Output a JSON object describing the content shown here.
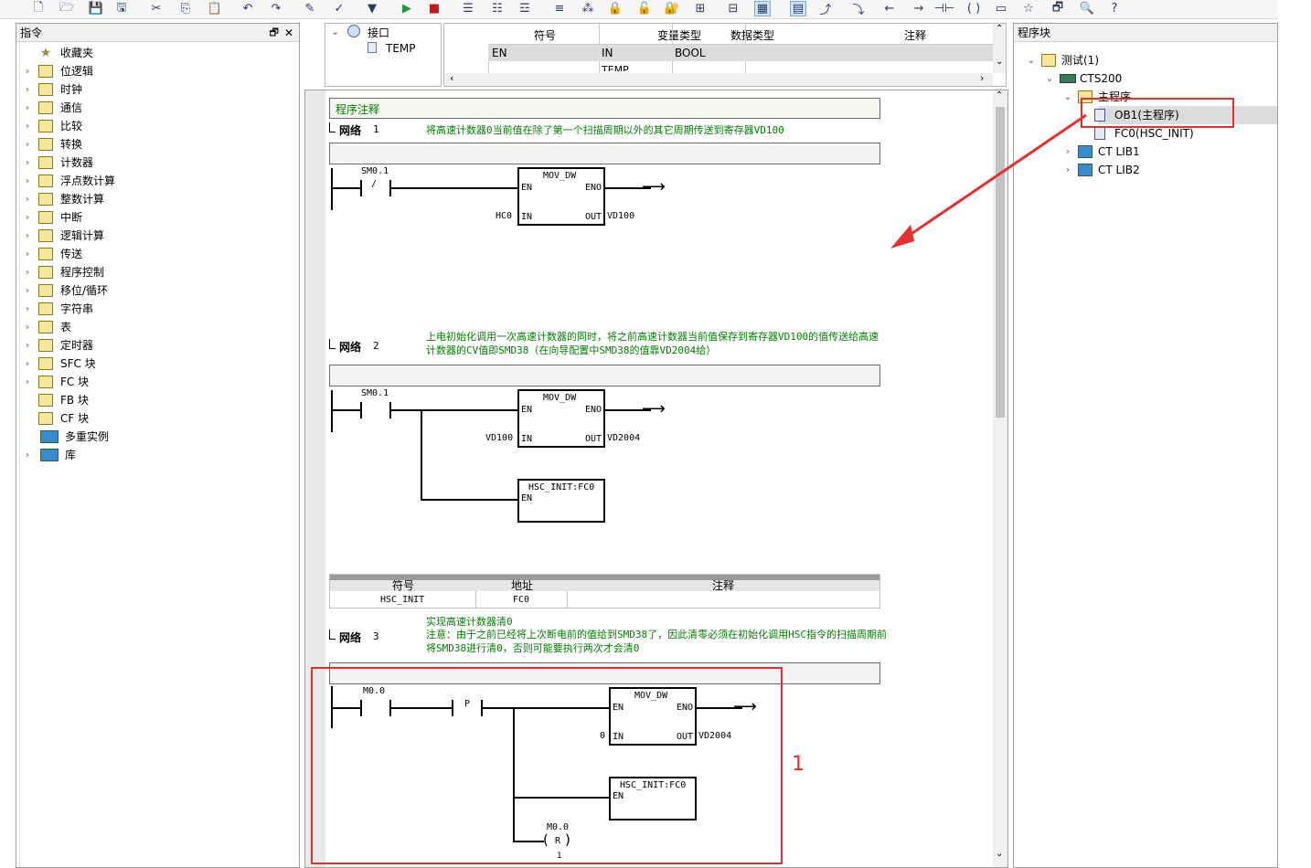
{
  "toolbar": {
    "icons": [
      "new-doc",
      "open-folder",
      "save",
      "save-all",
      "cut",
      "copy",
      "paste",
      "undo",
      "redo",
      "compile",
      "compile-all",
      "download",
      "run",
      "stop",
      "insert-network",
      "delete-network",
      "insert-row",
      "comment",
      "symbol",
      "lock-a",
      "lock-b",
      "lock-c",
      "mode-a",
      "mode-b",
      "ladder-view",
      "stl-view",
      "contact-up",
      "contact-down",
      "line-left",
      "line-right",
      "contact",
      "coil",
      "box",
      "bookmark",
      "window",
      "zoom",
      "help"
    ]
  },
  "left_panel": {
    "title": "指令",
    "items": [
      {
        "label": "收藏夹",
        "icon": "star-icon",
        "chevron": false
      },
      {
        "label": "位逻辑",
        "icon": "bit-logic-icon",
        "chevron": true
      },
      {
        "label": "时钟",
        "icon": "clock-icon",
        "chevron": true
      },
      {
        "label": "通信",
        "icon": "comm-icon",
        "chevron": true
      },
      {
        "label": "比较",
        "icon": "compare-icon",
        "chevron": true
      },
      {
        "label": "转换",
        "icon": "convert-icon",
        "chevron": true
      },
      {
        "label": "计数器",
        "icon": "counter-icon",
        "chevron": true
      },
      {
        "label": "浮点数计算",
        "icon": "float-icon",
        "chevron": true
      },
      {
        "label": "整数计算",
        "icon": "integer-icon",
        "chevron": true
      },
      {
        "label": "中断",
        "icon": "interrupt-icon",
        "chevron": true
      },
      {
        "label": "逻辑计算",
        "icon": "logic-icon",
        "chevron": true
      },
      {
        "label": "传送",
        "icon": "move-icon",
        "chevron": true
      },
      {
        "label": "程序控制",
        "icon": "program-control-icon",
        "chevron": true
      },
      {
        "label": "移位/循环",
        "icon": "shift-icon",
        "chevron": true
      },
      {
        "label": "字符串",
        "icon": "string-icon",
        "chevron": true
      },
      {
        "label": "表",
        "icon": "table-icon",
        "chevron": true
      },
      {
        "label": "定时器",
        "icon": "timer-icon",
        "chevron": true
      },
      {
        "label": "SFC 块",
        "icon": "sfc-icon",
        "chevron": true
      },
      {
        "label": "FC 块",
        "icon": "fc-icon",
        "chevron": true
      },
      {
        "label": "FB 块",
        "icon": "fb-icon",
        "chevron": false
      },
      {
        "label": "CF 块",
        "icon": "cf-icon",
        "chevron": false
      },
      {
        "label": "多重实例",
        "icon": "multi-instance-icon",
        "chevron": false
      },
      {
        "label": "库",
        "icon": "library-icon",
        "chevron": true
      }
    ]
  },
  "interface": {
    "root": "接口",
    "child": "TEMP"
  },
  "var_table": {
    "headers": [
      "符号",
      "变量类型",
      "数据类型",
      "注释"
    ],
    "row": [
      "EN",
      "IN",
      "BOOL",
      ""
    ],
    "next_row_partial": "TEMP"
  },
  "editor": {
    "program_comment": "程序注释",
    "networks": [
      {
        "label": "网络",
        "number": "1",
        "comment": "将高速计数器0当前值在除了第一个扫描周期以外的其它周期传送到寄存器VD100",
        "contact": "SM0.1",
        "contact_symbol": "/",
        "box_title": "MOV_DW",
        "en": "EN",
        "eno": "ENO",
        "in": "IN",
        "out": "OUT",
        "in_val": "HC0",
        "out_val": "VD100"
      },
      {
        "label": "网络",
        "number": "2",
        "comment": "上电初始化调用一次高速计数器的同时，将之前高速计数器当前值保存到寄存器VD100的值传送给高速计数器的CV值即SMD38（在向导配置中SMD38的值靠VD2004给）",
        "contact": "SM0.1",
        "box_title": "MOV_DW",
        "en": "EN",
        "eno": "ENO",
        "in": "IN",
        "out": "OUT",
        "in_val": "VD100",
        "out_val": "VD2004",
        "call_title": "HSC_INIT:FC0",
        "call_en": "EN"
      },
      {
        "label": "网络",
        "number": "3",
        "comment_line1": "实现高速计数器清0",
        "comment_line2": "注意：由于之前已经将上次断电前的值给到SMD38了，因此清零必须在初始化调用HSC指令的扫描周期前将SMD38进行清0，否则可能要执行两次才会清0",
        "contact": "M0.0",
        "edge": "P",
        "box_title": "MOV_DW",
        "en": "EN",
        "eno": "ENO",
        "in": "IN",
        "out": "OUT",
        "in_val": "0",
        "out_val": "VD2004",
        "call_title": "HSC_INIT:FC0",
        "call_en": "EN",
        "coil": "M0.0",
        "coil_type": "R",
        "coil_count": "1"
      }
    ],
    "symbol_table": {
      "headers": [
        "符号",
        "地址",
        "注释"
      ],
      "row": [
        "HSC_INIT",
        "FC0",
        ""
      ]
    }
  },
  "right_panel": {
    "title": "程序块",
    "tree": [
      {
        "label": "测试(1)",
        "level": 0,
        "icon": "project-icon"
      },
      {
        "label": "CTS200",
        "level": 1,
        "icon": "cpu-icon"
      },
      {
        "label": "主程序",
        "level": 2,
        "icon": "folder-icon"
      },
      {
        "label": "OB1(主程序)",
        "level": 3,
        "icon": "block-icon",
        "selected": true
      },
      {
        "label": "FC0(HSC_INIT)",
        "level": 3,
        "icon": "block-icon"
      },
      {
        "label": "CT LIB1",
        "level": 2,
        "icon": "library-icon"
      },
      {
        "label": "CT LIB2",
        "level": 2,
        "icon": "library-icon"
      }
    ]
  },
  "annotation": {
    "label": "1",
    "color": "#e53030"
  }
}
